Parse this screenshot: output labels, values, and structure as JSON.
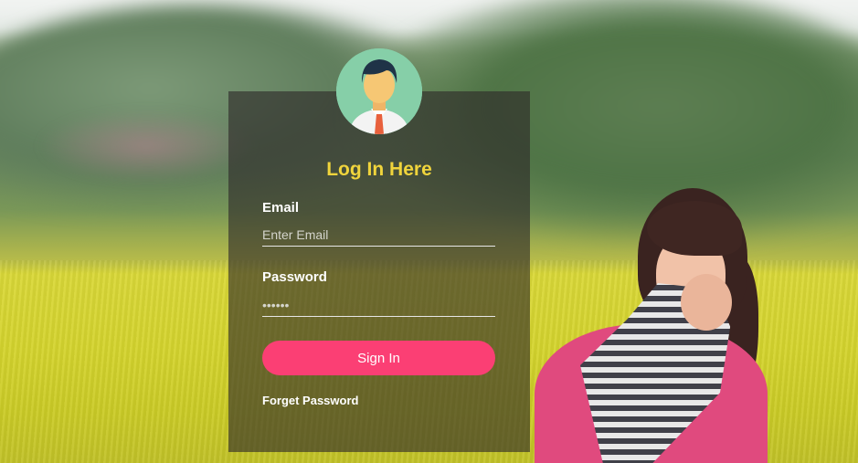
{
  "login": {
    "title": "Log In Here",
    "email_label": "Email",
    "email_placeholder": "Enter Email",
    "email_value": "",
    "password_label": "Password",
    "password_value": "",
    "password_placeholder": "••••••",
    "signin_label": "Sign In",
    "forget_label": "Forget Password"
  },
  "avatar": {
    "icon": "user-avatar-icon"
  },
  "colors": {
    "title": "#f0d43c",
    "button": "#fb3f74",
    "avatar_bg": "#86cfa8"
  }
}
